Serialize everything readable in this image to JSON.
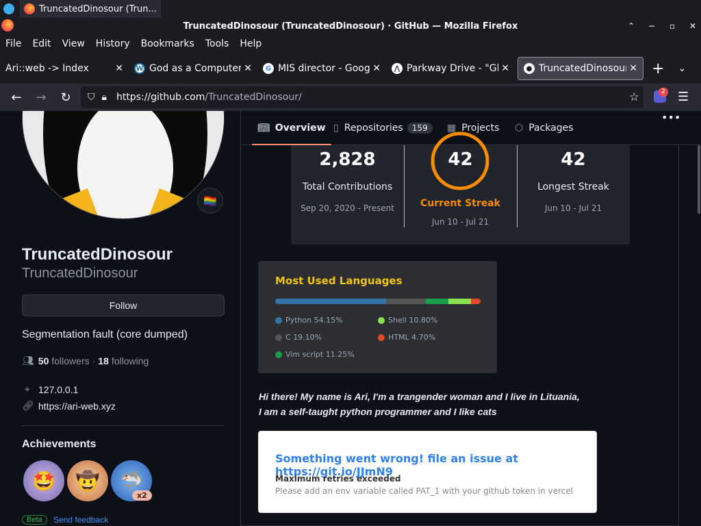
{
  "taskbar": {
    "task_label": "TruncatedDinosour (Trun..."
  },
  "window": {
    "title": "TruncatedDinosour (TruncatedDinosour) · GitHub — Mozilla Firefox"
  },
  "menubar": {
    "items": [
      "File",
      "Edit",
      "View",
      "History",
      "Bookmarks",
      "Tools",
      "Help"
    ]
  },
  "tabs": [
    {
      "label": "Ari::web -> Index",
      "icon": "none"
    },
    {
      "label": "God as a Computer",
      "icon": "wordpress-icon"
    },
    {
      "label": "MIS director - Googl",
      "icon": "google-icon"
    },
    {
      "label": "Parkway Drive - \"Gl",
      "icon": "nature-icon"
    },
    {
      "label": "TruncatedDinosour",
      "icon": "github-icon",
      "active": true
    }
  ],
  "navbar": {
    "url_host": "https://github.com",
    "url_path": "/TruncatedDinosour/",
    "extension_badge": "2"
  },
  "profile_tabs": {
    "overview": "Overview",
    "repositories": "Repositories",
    "repositories_count": "159",
    "projects": "Projects",
    "packages": "Packages",
    "more": "•••"
  },
  "profile": {
    "name": "TruncatedDinosour",
    "login": "TruncatedDinosour",
    "follow_label": "Follow",
    "bio": "Segmentation fault (core dumped)",
    "followers": "50",
    "followers_label": "followers",
    "following": "18",
    "following_label": "following",
    "location": "127.0.0.1",
    "website": "https://ari-web.xyz",
    "status_emoji": "🏳️‍🌈"
  },
  "achievements": {
    "title": "Achievements",
    "badges": [
      "🤩",
      "🤠",
      "🦈"
    ],
    "badge_multiplier": "x2",
    "beta_label": "Beta",
    "feedback_label": "Send feedback"
  },
  "streak": {
    "total_contributions": "2,828",
    "total_label": "Total Contributions",
    "total_range": "Sep 20, 2020 - Present",
    "current_streak": "42",
    "current_label": "Current Streak",
    "current_range": "Jun 10 - Jul 21",
    "longest_streak": "42",
    "longest_label": "Longest Streak",
    "longest_range": "Jun 10 - Jul 21",
    "accent_color": "#fb8c00"
  },
  "languages": {
    "title": "Most Used Languages",
    "items": [
      {
        "name": "Python",
        "percent": "54.15%",
        "value": 54.15,
        "color": "#3572A5"
      },
      {
        "name": "C",
        "percent": "19.10%",
        "value": 19.1,
        "color": "#555555"
      },
      {
        "name": "Vim script",
        "percent": "11.25%",
        "value": 11.25,
        "color": "#199f4b"
      },
      {
        "name": "Shell",
        "percent": "10.80%",
        "value": 10.8,
        "color": "#89e051"
      },
      {
        "name": "HTML",
        "percent": "4.70%",
        "value": 4.7,
        "color": "#e34c26"
      }
    ]
  },
  "intro": {
    "line1": "Hi there! My name is Ari, I'm a trangender woman and I live in Lituania,",
    "line2": "I am a self-taught python programmer and I like cats"
  },
  "error_card": {
    "title": "Something went wrong! file an issue at https://git.io/JJmN9",
    "heading": "Maximum retries exceeded",
    "message": "Please add an env variable called PAT_1 with your github token in vercel"
  }
}
